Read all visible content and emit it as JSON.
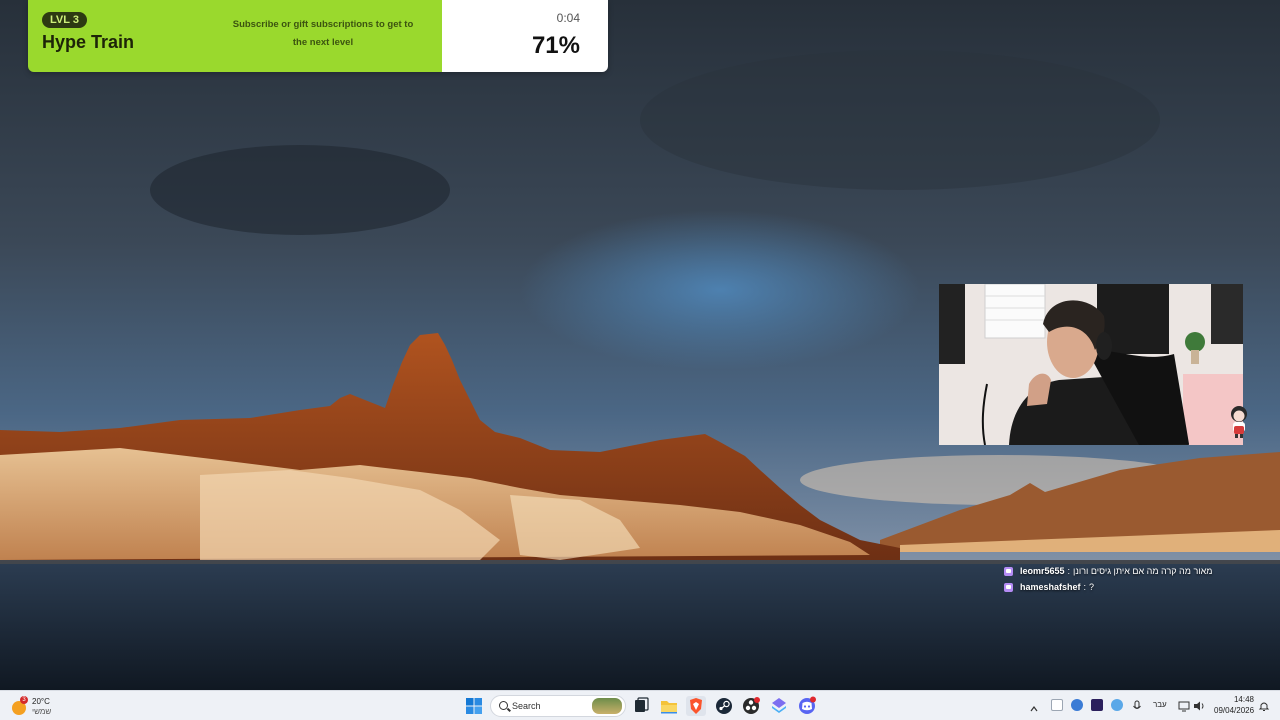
{
  "hype_train": {
    "level": "LVL 3",
    "title": "Hype Train",
    "description": "Subscribe or gift subscriptions to get to the next level",
    "timer": "0:04",
    "progress": "71%",
    "progress_fraction": 0.71,
    "accent": "#9ad92d"
  },
  "chat": {
    "messages": [
      {
        "user": "leomr5655",
        "separator": ":",
        "text": "מאור מה קרה מה אם איתן גיסים ורונן"
      },
      {
        "user": "hameshafshef",
        "separator": ":",
        "text": "?"
      }
    ],
    "badge_icon": "twitch-badge-icon",
    "badge_color": "#b58cf5"
  },
  "taskbar": {
    "weather": {
      "temperature": "20°C",
      "condition": "שמשי",
      "badge": "3"
    },
    "search": {
      "placeholder": "Search"
    },
    "pinned_apps": [
      "windows-start-icon",
      "task-view-icon",
      "file-explorer-icon",
      "brave-browser-icon",
      "steam-icon",
      "obs-studio-icon",
      "app-icon",
      "discord-icon"
    ],
    "tray": {
      "language": "עבר",
      "time": "14:48",
      "date": "09/04/2026"
    }
  }
}
